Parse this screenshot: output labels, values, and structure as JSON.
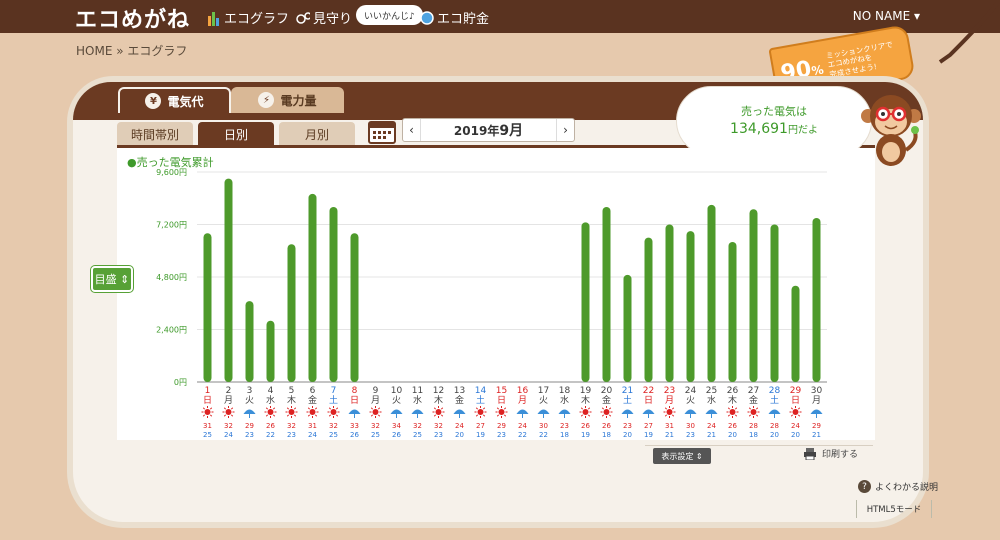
{
  "header": {
    "logo": "エコめがね",
    "nav": [
      "エコグラフ",
      "見守り",
      "エコ貯金"
    ],
    "pill": "いいかんじ♪",
    "user": "NO NAME ▾"
  },
  "breadcrumb": {
    "home": "HOME",
    "sep": "»",
    "current": "エコグラフ"
  },
  "mission": {
    "percent": "90",
    "unit": "%",
    "text": [
      "ミッションクリアで",
      "エコめがねを",
      "完成させよう!"
    ]
  },
  "tabs": {
    "main": [
      "電気代",
      "電力量"
    ],
    "main_icons": [
      "¥",
      "⚡"
    ],
    "sub": [
      "時間帯別",
      "日別",
      "月別"
    ]
  },
  "date": {
    "year": "2019年",
    "month": "9月",
    "prev": "‹",
    "next": "›"
  },
  "bubble": {
    "line1": "売った電気は",
    "value": "134,691",
    "unit": "円だよ"
  },
  "chart_data": {
    "type": "bar",
    "legend": "●売った電気累計",
    "ylim": [
      0,
      9600
    ],
    "yticks": [
      "0円",
      "2,400円",
      "4,800円",
      "7,200円",
      "9,600円"
    ],
    "categories": [
      "1",
      "2",
      "3",
      "4",
      "5",
      "6",
      "7",
      "8",
      "9",
      "10",
      "11",
      "12",
      "13",
      "14",
      "15",
      "16",
      "17",
      "18",
      "19",
      "20",
      "21",
      "22",
      "23",
      "24",
      "25",
      "26",
      "27",
      "28",
      "29",
      "30"
    ],
    "weekdays": [
      "日",
      "月",
      "火",
      "水",
      "木",
      "金",
      "土",
      "日",
      "月",
      "火",
      "水",
      "木",
      "金",
      "土",
      "日",
      "月",
      "火",
      "水",
      "木",
      "金",
      "土",
      "日",
      "月",
      "火",
      "水",
      "木",
      "金",
      "土",
      "日",
      "月"
    ],
    "day_colors": [
      "red",
      "black",
      "black",
      "black",
      "black",
      "black",
      "blue",
      "red",
      "black",
      "black",
      "black",
      "black",
      "black",
      "blue",
      "red",
      "red",
      "black",
      "black",
      "black",
      "black",
      "blue",
      "red",
      "red",
      "black",
      "black",
      "black",
      "black",
      "blue",
      "red",
      "black"
    ],
    "values": [
      6800,
      9300,
      3700,
      2800,
      6300,
      8600,
      8000,
      6800,
      0,
      0,
      0,
      0,
      0,
      0,
      0,
      0,
      0,
      0,
      7300,
      8000,
      4900,
      6600,
      7200,
      6900,
      8100,
      6400,
      7900,
      7200,
      4400,
      7500
    ],
    "weather": [
      "sun",
      "sun",
      "umbrella",
      "sun",
      "sun",
      "sun",
      "sun",
      "umbrella",
      "sun",
      "umbrella",
      "umbrella",
      "sun",
      "umbrella",
      "sun",
      "sun",
      "umbrella",
      "umbrella",
      "umbrella",
      "sun",
      "sun",
      "umbrella",
      "umbrella",
      "sun",
      "umbrella",
      "umbrella",
      "sun",
      "sun",
      "umbrella",
      "sun",
      "umbrella"
    ],
    "temp_high": [
      "31",
      "32",
      "29",
      "26",
      "32",
      "31",
      "32",
      "33",
      "32",
      "34",
      "32",
      "32",
      "24",
      "27",
      "29",
      "24",
      "30",
      "23",
      "26",
      "26",
      "23",
      "27",
      "31",
      "30",
      "24",
      "26",
      "28",
      "28",
      "24",
      "29"
    ],
    "temp_low": [
      "25",
      "24",
      "23",
      "22",
      "23",
      "24",
      "25",
      "26",
      "25",
      "26",
      "25",
      "23",
      "20",
      "19",
      "23",
      "22",
      "22",
      "18",
      "19",
      "18",
      "20",
      "19",
      "21",
      "23",
      "21",
      "20",
      "18",
      "20",
      "20",
      "21"
    ],
    "color": "#4e9a2b"
  },
  "controls": {
    "goal": "目盛 ⇕",
    "display": "表示設定 ⇕",
    "print": "印刷する",
    "help": "よくわかる説明",
    "html5": "HTML5モード"
  }
}
